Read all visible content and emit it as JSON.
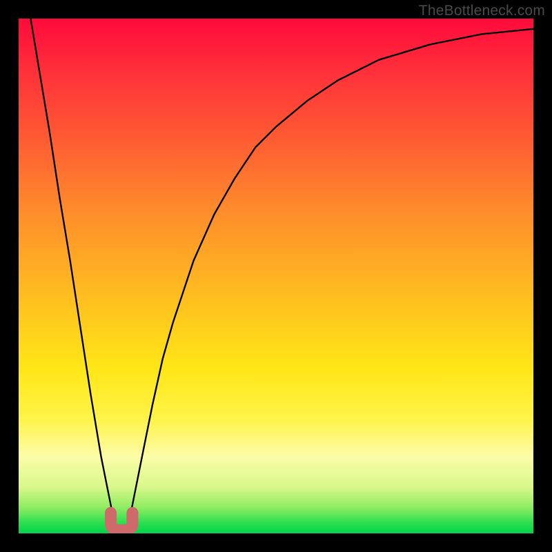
{
  "watermark": "TheBottleneck.com",
  "colors": {
    "frame": "#000000",
    "curve": "#000000",
    "marker": "#cf6a6b"
  },
  "chart_data": {
    "type": "line",
    "title": "",
    "xlabel": "",
    "ylabel": "",
    "xlim": [
      0,
      100
    ],
    "ylim": [
      0,
      100
    ],
    "grid": false,
    "legend": false,
    "x": [
      0,
      2,
      4,
      6,
      8,
      10,
      12,
      14,
      16,
      18,
      19,
      20,
      21,
      22,
      24,
      26,
      28,
      30,
      34,
      38,
      42,
      46,
      50,
      56,
      62,
      70,
      80,
      90,
      100
    ],
    "values": [
      115,
      102,
      90,
      78,
      65,
      53,
      40,
      27,
      15,
      5,
      1,
      0,
      1,
      5,
      15,
      25,
      34,
      41,
      53,
      62,
      69,
      75,
      79,
      84,
      88,
      92,
      95,
      97,
      98
    ],
    "minimum_x": 20,
    "minimum_y": 0,
    "marker": {
      "center_x": 20,
      "width": 4.2,
      "height": 4.0
    }
  }
}
